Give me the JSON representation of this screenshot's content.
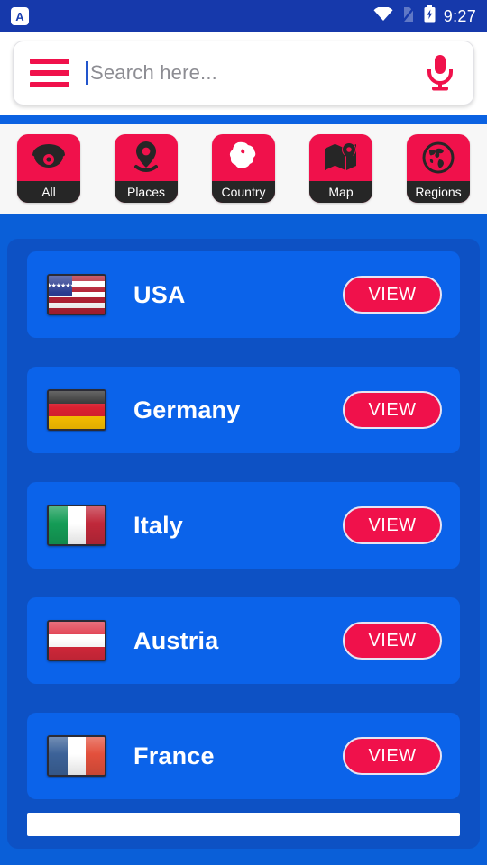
{
  "status_bar": {
    "notification_letter": "A",
    "time": "9:27",
    "icons": [
      "wifi-icon",
      "sim-disabled-icon",
      "battery-charging-icon"
    ],
    "background_color": "#1639ab"
  },
  "search": {
    "menu_icon": "hamburger-menu-icon",
    "placeholder": "Search here...",
    "value": "",
    "mic_icon": "microphone-icon",
    "accent_color": "#f0114b"
  },
  "tabs": [
    {
      "label": "All",
      "icon": "cctv-camera-icon"
    },
    {
      "label": "Places",
      "icon": "map-pin-icon"
    },
    {
      "label": "Country",
      "icon": "landmass-shape-icon"
    },
    {
      "label": "Map",
      "icon": "folded-map-pin-icon"
    },
    {
      "label": "Regions",
      "icon": "globe-icon"
    }
  ],
  "list": {
    "action_label": "VIEW",
    "items": [
      {
        "name": "USA",
        "flag": "flag-usa"
      },
      {
        "name": "Germany",
        "flag": "flag-germany"
      },
      {
        "name": "Italy",
        "flag": "flag-italy"
      },
      {
        "name": "Austria",
        "flag": "flag-austria"
      },
      {
        "name": "France",
        "flag": "flag-france"
      }
    ]
  },
  "theme": {
    "page_blue": "#0a5fd8",
    "container_blue": "#0d51c4",
    "card_blue": "#0b63ea",
    "accent_red": "#f0114b",
    "tab_label_dark": "#262626"
  }
}
